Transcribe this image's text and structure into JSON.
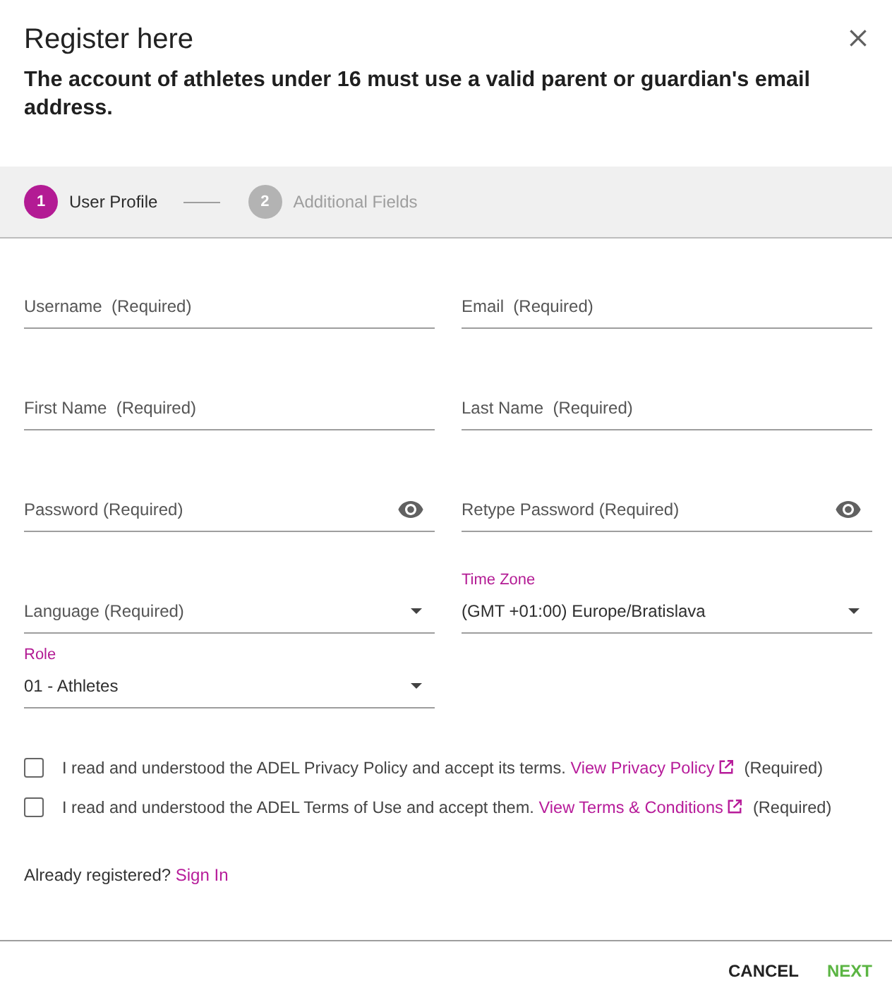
{
  "dialog": {
    "title": "Register here",
    "subtitle": "The account of athletes under 16 must use a valid parent or guardian's email address."
  },
  "stepper": [
    {
      "number": "1",
      "label": "User Profile",
      "selected": true
    },
    {
      "number": "2",
      "label": "Additional Fields",
      "selected": false
    }
  ],
  "field_columns": [
    {
      "fields": [
        {
          "kind": "text",
          "placeholder": "Username  (Required)"
        },
        {
          "kind": "text",
          "placeholder": "First Name  (Required)"
        },
        {
          "kind": "password",
          "placeholder": "Password (Required)"
        },
        {
          "kind": "select",
          "placeholder": "Language (Required)"
        },
        {
          "kind": "select",
          "label": "Role",
          "value": "01 - Athletes"
        }
      ]
    },
    {
      "fields": [
        {
          "kind": "text",
          "placeholder": "Email  (Required)"
        },
        {
          "kind": "text",
          "placeholder": "Last Name  (Required)"
        },
        {
          "kind": "password",
          "placeholder": "Retype Password (Required)"
        },
        {
          "kind": "select",
          "label": "Time Zone",
          "value": "(GMT +01:00) Europe/Bratislava"
        }
      ]
    }
  ],
  "consents": [
    {
      "text": "I read and understood the ADEL Privacy Policy and accept its terms.",
      "link": "View Privacy Policy",
      "suffix": "(Required)",
      "checked": false
    },
    {
      "text": "I read and understood the ADEL Terms of Use and accept them.",
      "link": "View Terms & Conditions",
      "suffix": "(Required)",
      "checked": false
    }
  ],
  "sign_in": {
    "text": "Already registered?",
    "link": "Sign In"
  },
  "buttons": [
    {
      "label": "CANCEL",
      "kind": "secondary"
    },
    {
      "label": "NEXT",
      "kind": "primary"
    }
  ]
}
